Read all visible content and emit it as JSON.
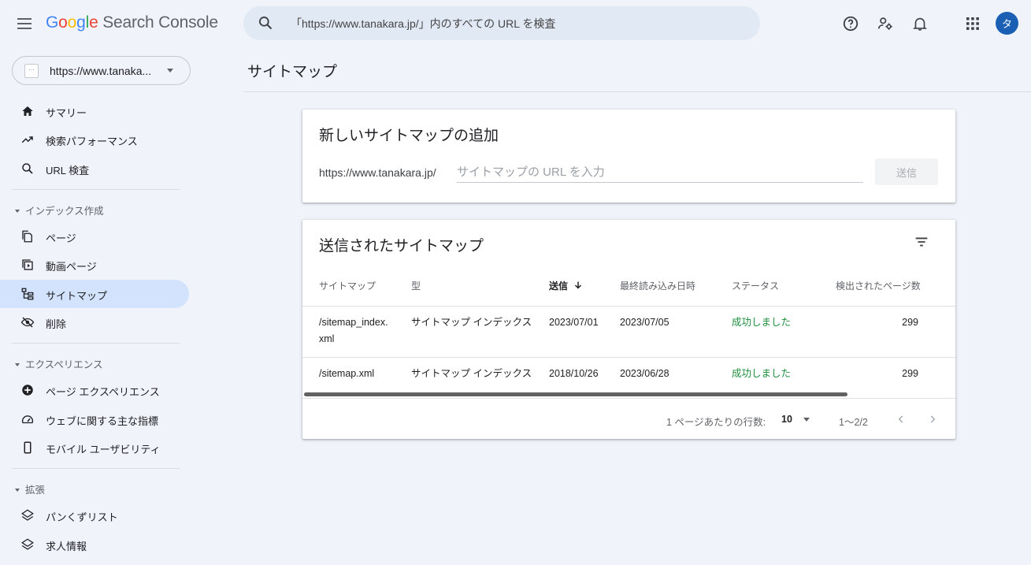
{
  "header": {
    "menu_icon": "hamburger-menu-icon",
    "logo_google": [
      "G",
      "o",
      "o",
      "g",
      "l",
      "e"
    ],
    "product_name": "Search Console",
    "search_placeholder": "「https://www.tanakara.jp/」内のすべての URL を検査",
    "help_icon": "help-circle-icon",
    "users_settings_icon": "user-settings-icon",
    "notifications_icon": "bell-icon",
    "apps_icon": "apps-grid-icon",
    "avatar_initial": "タ",
    "colors": {
      "google_blue": "#4285f4",
      "google_red": "#ea4335",
      "google_yellow": "#fbbc05",
      "google_green": "#34a853",
      "avatar_bg": "#1a5fb4"
    }
  },
  "property_selector": {
    "label": "https://www.tanaka...",
    "favicon_text": "…"
  },
  "sidebar": {
    "top_items": [
      {
        "label": "サマリー",
        "icon": "home-icon"
      },
      {
        "label": "検索パフォーマンス",
        "icon": "trending-up-icon"
      },
      {
        "label": "URL 検査",
        "icon": "search-icon"
      }
    ],
    "sections": [
      {
        "title": "インデックス作成",
        "items": [
          {
            "label": "ページ",
            "icon": "pages-icon"
          },
          {
            "label": "動画ページ",
            "icon": "video-pages-icon"
          },
          {
            "label": "サイトマップ",
            "icon": "sitemap-icon",
            "active": true
          },
          {
            "label": "削除",
            "icon": "visibility-off-icon"
          }
        ]
      },
      {
        "title": "エクスペリエンス",
        "items": [
          {
            "label": "ページ エクスペリエンス",
            "icon": "add-circle-icon"
          },
          {
            "label": "ウェブに関する主な指標",
            "icon": "speed-gauge-icon"
          },
          {
            "label": "モバイル ユーザビリティ",
            "icon": "smartphone-icon"
          }
        ]
      },
      {
        "title": "拡張",
        "items": [
          {
            "label": "パンくずリスト",
            "icon": "layers-icon"
          },
          {
            "label": "求人情報",
            "icon": "layers-icon"
          }
        ]
      }
    ],
    "active_color": "#d3e3fd"
  },
  "main": {
    "page_title": "サイトマップ",
    "add_card": {
      "title": "新しいサイトマップの追加",
      "url_prefix": "https://www.tanakara.jp/",
      "input_placeholder": "サイトマップの URL を入力",
      "input_value": "",
      "submit_label": "送信"
    },
    "submitted_card": {
      "title": "送信されたサイトマップ",
      "filter_icon": "filter-list-icon",
      "columns": [
        "サイトマップ",
        "型",
        "送信",
        "最終読み込み日時",
        "ステータス",
        "検出されたページ数"
      ],
      "sorted_column": "送信",
      "sort_icon": "arrow-down-icon",
      "rows": [
        {
          "sitemap_line1": "/sitemap_index.",
          "sitemap_line2": "xml",
          "type": "サイトマップ インデックス",
          "submitted": "2023/07/01",
          "last_read": "2023/07/05",
          "status": "成功しました",
          "pages": "299"
        },
        {
          "sitemap_line1": "/sitemap.xml",
          "sitemap_line2": "",
          "type": "サイトマップ インデックス",
          "submitted": "2018/10/26",
          "last_read": "2023/06/28",
          "status": "成功しました",
          "pages": "299"
        }
      ],
      "status_color": "#1e8e3e",
      "pagination": {
        "rows_per_page_label": "1 ページあたりの行数:",
        "rows_per_page_value": "10",
        "range": "1〜2/2",
        "prev_icon": "chevron-left-icon",
        "next_icon": "chevron-right-icon"
      }
    }
  }
}
